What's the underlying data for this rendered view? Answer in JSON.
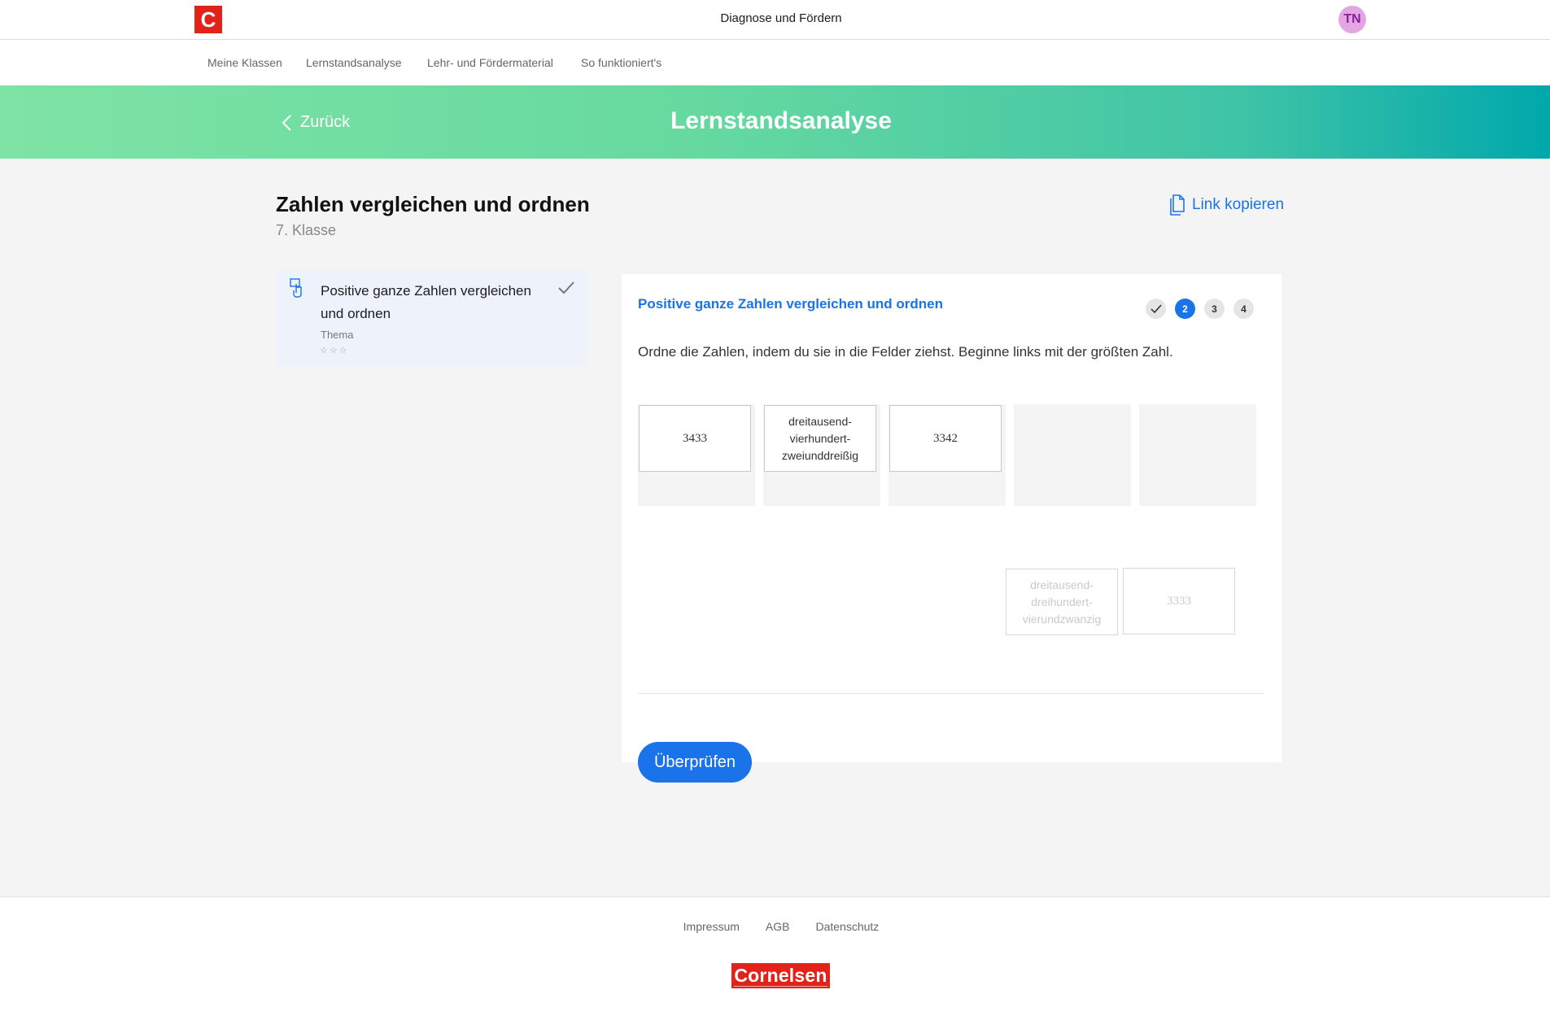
{
  "header": {
    "logo_letter": "C",
    "app_title": "Diagnose und Fördern",
    "avatar_initials": "TN"
  },
  "nav": {
    "items": [
      "Meine Klassen",
      "Lernstandsanalyse",
      "Lehr- und Fördermaterial",
      "So funktioniert's"
    ]
  },
  "banner": {
    "back_label": "Zurück",
    "title": "Lernstandsanalyse"
  },
  "page": {
    "title": "Zahlen vergleichen und ordnen",
    "subtitle": "7. Klasse",
    "copy_link_label": "Link kopieren"
  },
  "topic": {
    "title": "Positive ganze Zahlen vergleichen und ordnen",
    "label": "Thema",
    "stars_total": 3,
    "stars_filled": 0,
    "completed": true
  },
  "task": {
    "title": "Positive ganze Zahlen vergleichen und ordnen",
    "steps": [
      {
        "label": "",
        "state": "done"
      },
      {
        "label": "2",
        "state": "active"
      },
      {
        "label": "3",
        "state": "pending"
      },
      {
        "label": "4",
        "state": "pending"
      }
    ],
    "instruction": "Ordne die Zahlen, indem du sie in die Felder ziehst. Beginne links mit der größten Zahl.",
    "placed_tiles": [
      "3433",
      "dreitausend-\nvierhundert-\nzweiunddreißig",
      "3342"
    ],
    "remaining_tiles": [
      "dreitausend-\ndreihundert-\nvierundzwanzig",
      "3333"
    ],
    "check_button_label": "Überprüfen"
  },
  "footer": {
    "links": [
      "Impressum",
      "AGB",
      "Datenschutz"
    ],
    "logo_text": "Cornelsen"
  },
  "colors": {
    "accent": "#1a73e8",
    "brand_red": "#e2231a",
    "banner_start": "#7ee3a4",
    "banner_end": "#00a8ac"
  }
}
